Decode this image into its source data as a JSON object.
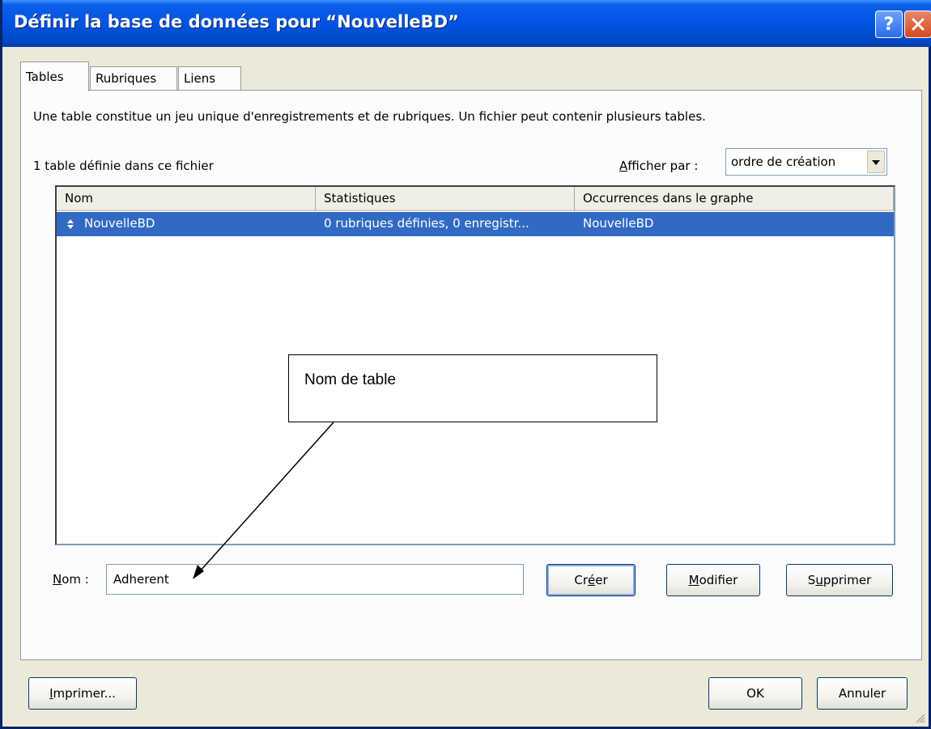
{
  "window": {
    "title": "Définir la base de données pour “NouvelleBD”",
    "help_label": "?",
    "close_label": "✕"
  },
  "tabs": [
    {
      "label": "Tables",
      "active": true
    },
    {
      "label": "Rubriques",
      "active": false
    },
    {
      "label": "Liens",
      "active": false
    }
  ],
  "panel": {
    "description": "Une table constitue un jeu unique d'enregistrements et de rubriques. Un fichier peut contenir plusieurs tables.",
    "count_text": "1 table définie dans ce fichier",
    "sort_label_first": "A",
    "sort_label_rest": "fficher par :",
    "sort_value": "ordre de création"
  },
  "table": {
    "columns": [
      "Nom",
      "Statistiques",
      "Occurrences dans le graphe"
    ],
    "rows": [
      {
        "name": "NouvelleBD",
        "stats": "0 rubriques définies, 0 enregistr...",
        "occurrences": "NouvelleBD",
        "selected": true
      }
    ]
  },
  "form": {
    "name_label_first": "N",
    "name_label_rest": "om :",
    "name_value": "Adherent"
  },
  "buttons": {
    "create_first": "Cr",
    "create_key": "é",
    "create_rest": "er",
    "modify_first": "M",
    "modify_rest": "odifier",
    "delete_first": "S",
    "delete_key": "u",
    "delete_rest": "pprimer",
    "print_first": "I",
    "print_rest": "mprimer...",
    "ok": "OK",
    "cancel": "Annuler"
  },
  "annotation": {
    "text": "Nom de table"
  },
  "colors": {
    "title_bar": "#0054e3",
    "selection": "#316ac5",
    "dialog_bg": "#ece9d8"
  }
}
